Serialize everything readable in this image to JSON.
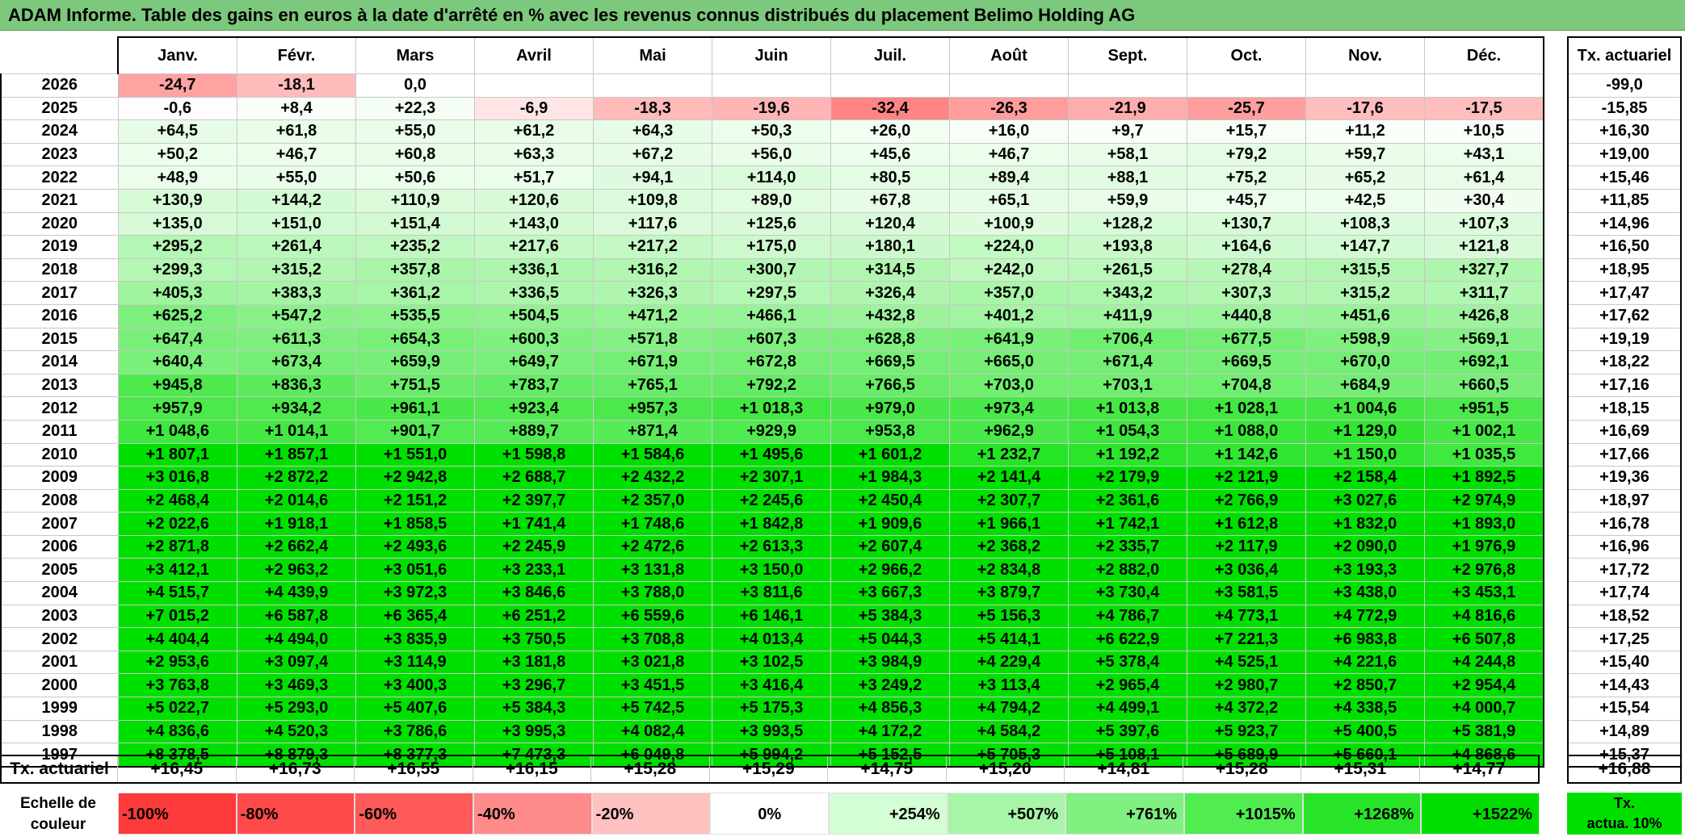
{
  "title": "ADAM Informe. Table des gains en euros à la date d'arrêté en % avec les revenus connus distribués du placement Belimo Holding AG",
  "months": [
    "Janv.",
    "Févr.",
    "Mars",
    "Avril",
    "Mai",
    "Juin",
    "Juil.",
    "Août",
    "Sept.",
    "Oct.",
    "Nov.",
    "Déc."
  ],
  "actu_header": "Tx. actuariel",
  "colors": {
    "title_bg": "#7cc87c",
    "neg_max": "#ff3030",
    "pos_max": "#00e000",
    "neutral": "#ffffff"
  },
  "chart_data": {
    "type": "heatmap",
    "title": "ADAM Informe. Table des gains en euros à la date d'arrêté en % avec les revenus connus distribués du placement Belimo Holding AG",
    "columns": [
      "Janv.",
      "Févr.",
      "Mars",
      "Avril",
      "Mai",
      "Juin",
      "Juil.",
      "Août",
      "Sept.",
      "Oct.",
      "Nov.",
      "Déc."
    ],
    "rows": [
      {
        "year": "2026",
        "values": [
          "-24,7",
          "-18,1",
          "0,0",
          "",
          "",
          "",
          "",
          "",
          "",
          "",
          "",
          ""
        ],
        "actu": "-99,0"
      },
      {
        "year": "2025",
        "values": [
          "-0,6",
          "+8,4",
          "+22,3",
          "-6,9",
          "-18,3",
          "-19,6",
          "-32,4",
          "-26,3",
          "-21,9",
          "-25,7",
          "-17,6",
          "-17,5"
        ],
        "actu": "-15,85"
      },
      {
        "year": "2024",
        "values": [
          "+64,5",
          "+61,8",
          "+55,0",
          "+61,2",
          "+64,3",
          "+50,3",
          "+26,0",
          "+16,0",
          "+9,7",
          "+15,7",
          "+11,2",
          "+10,5"
        ],
        "actu": "+16,30"
      },
      {
        "year": "2023",
        "values": [
          "+50,2",
          "+46,7",
          "+60,8",
          "+63,3",
          "+67,2",
          "+56,0",
          "+45,6",
          "+46,7",
          "+58,1",
          "+79,2",
          "+59,7",
          "+43,1"
        ],
        "actu": "+19,00"
      },
      {
        "year": "2022",
        "values": [
          "+48,9",
          "+55,0",
          "+50,6",
          "+51,7",
          "+94,1",
          "+114,0",
          "+80,5",
          "+89,4",
          "+88,1",
          "+75,2",
          "+65,2",
          "+61,4"
        ],
        "actu": "+15,46"
      },
      {
        "year": "2021",
        "values": [
          "+130,9",
          "+144,2",
          "+110,9",
          "+120,6",
          "+109,8",
          "+89,0",
          "+67,8",
          "+65,1",
          "+59,9",
          "+45,7",
          "+42,5",
          "+30,4"
        ],
        "actu": "+11,85"
      },
      {
        "year": "2020",
        "values": [
          "+135,0",
          "+151,0",
          "+151,4",
          "+143,0",
          "+117,6",
          "+125,6",
          "+120,4",
          "+100,9",
          "+128,2",
          "+130,7",
          "+108,3",
          "+107,3"
        ],
        "actu": "+14,96"
      },
      {
        "year": "2019",
        "values": [
          "+295,2",
          "+261,4",
          "+235,2",
          "+217,6",
          "+217,2",
          "+175,0",
          "+180,1",
          "+224,0",
          "+193,8",
          "+164,6",
          "+147,7",
          "+121,8"
        ],
        "actu": "+16,50"
      },
      {
        "year": "2018",
        "values": [
          "+299,3",
          "+315,2",
          "+357,8",
          "+336,1",
          "+316,2",
          "+300,7",
          "+314,5",
          "+242,0",
          "+261,5",
          "+278,4",
          "+315,5",
          "+327,7"
        ],
        "actu": "+18,95"
      },
      {
        "year": "2017",
        "values": [
          "+405,3",
          "+383,3",
          "+361,2",
          "+336,5",
          "+326,3",
          "+297,5",
          "+326,4",
          "+357,0",
          "+343,2",
          "+307,3",
          "+315,2",
          "+311,7"
        ],
        "actu": "+17,47"
      },
      {
        "year": "2016",
        "values": [
          "+625,2",
          "+547,2",
          "+535,5",
          "+504,5",
          "+471,2",
          "+466,1",
          "+432,8",
          "+401,2",
          "+411,9",
          "+440,8",
          "+451,6",
          "+426,8"
        ],
        "actu": "+17,62"
      },
      {
        "year": "2015",
        "values": [
          "+647,4",
          "+611,3",
          "+654,3",
          "+600,3",
          "+571,8",
          "+607,3",
          "+628,8",
          "+641,9",
          "+706,4",
          "+677,5",
          "+598,9",
          "+569,1"
        ],
        "actu": "+19,19"
      },
      {
        "year": "2014",
        "values": [
          "+640,4",
          "+673,4",
          "+659,9",
          "+649,7",
          "+671,9",
          "+672,8",
          "+669,5",
          "+665,0",
          "+671,4",
          "+669,5",
          "+670,0",
          "+692,1"
        ],
        "actu": "+18,22"
      },
      {
        "year": "2013",
        "values": [
          "+945,8",
          "+836,3",
          "+751,5",
          "+783,7",
          "+765,1",
          "+792,2",
          "+766,5",
          "+703,0",
          "+703,1",
          "+704,8",
          "+684,9",
          "+660,5"
        ],
        "actu": "+17,16"
      },
      {
        "year": "2012",
        "values": [
          "+957,9",
          "+934,2",
          "+961,1",
          "+923,4",
          "+957,3",
          "+1 018,3",
          "+979,0",
          "+973,4",
          "+1 013,8",
          "+1 028,1",
          "+1 004,6",
          "+951,5"
        ],
        "actu": "+18,15"
      },
      {
        "year": "2011",
        "values": [
          "+1 048,6",
          "+1 014,1",
          "+901,7",
          "+889,7",
          "+871,4",
          "+929,9",
          "+953,8",
          "+962,9",
          "+1 054,3",
          "+1 088,0",
          "+1 129,0",
          "+1 002,1"
        ],
        "actu": "+16,69"
      },
      {
        "year": "2010",
        "values": [
          "+1 807,1",
          "+1 857,1",
          "+1 551,0",
          "+1 598,8",
          "+1 584,6",
          "+1 495,6",
          "+1 601,2",
          "+1 232,7",
          "+1 192,2",
          "+1 142,6",
          "+1 150,0",
          "+1 035,5"
        ],
        "actu": "+17,66"
      },
      {
        "year": "2009",
        "values": [
          "+3 016,8",
          "+2 872,2",
          "+2 942,8",
          "+2 688,7",
          "+2 432,2",
          "+2 307,1",
          "+1 984,3",
          "+2 141,4",
          "+2 179,9",
          "+2 121,9",
          "+2 158,4",
          "+1 892,5"
        ],
        "actu": "+19,36"
      },
      {
        "year": "2008",
        "values": [
          "+2 468,4",
          "+2 014,6",
          "+2 151,2",
          "+2 397,7",
          "+2 357,0",
          "+2 245,6",
          "+2 450,4",
          "+2 307,7",
          "+2 361,6",
          "+2 766,9",
          "+3 027,6",
          "+2 974,9"
        ],
        "actu": "+18,97"
      },
      {
        "year": "2007",
        "values": [
          "+2 022,6",
          "+1 918,1",
          "+1 858,5",
          "+1 741,4",
          "+1 748,6",
          "+1 842,8",
          "+1 909,6",
          "+1 966,1",
          "+1 742,1",
          "+1 612,8",
          "+1 832,0",
          "+1 893,0"
        ],
        "actu": "+16,78"
      },
      {
        "year": "2006",
        "values": [
          "+2 871,8",
          "+2 662,4",
          "+2 493,6",
          "+2 245,9",
          "+2 472,6",
          "+2 613,3",
          "+2 607,4",
          "+2 368,2",
          "+2 335,7",
          "+2 117,9",
          "+2 090,0",
          "+1 976,9"
        ],
        "actu": "+16,96"
      },
      {
        "year": "2005",
        "values": [
          "+3 412,1",
          "+2 963,2",
          "+3 051,6",
          "+3 233,1",
          "+3 131,8",
          "+3 150,0",
          "+2 966,2",
          "+2 834,8",
          "+2 882,0",
          "+3 036,4",
          "+3 193,3",
          "+2 976,8"
        ],
        "actu": "+17,72"
      },
      {
        "year": "2004",
        "values": [
          "+4 515,7",
          "+4 439,9",
          "+3 972,3",
          "+3 846,6",
          "+3 788,0",
          "+3 811,6",
          "+3 667,3",
          "+3 879,7",
          "+3 730,4",
          "+3 581,5",
          "+3 438,0",
          "+3 453,1"
        ],
        "actu": "+17,74"
      },
      {
        "year": "2003",
        "values": [
          "+7 015,2",
          "+6 587,8",
          "+6 365,4",
          "+6 251,2",
          "+6 559,6",
          "+6 146,1",
          "+5 384,3",
          "+5 156,3",
          "+4 786,7",
          "+4 773,1",
          "+4 772,9",
          "+4 816,6"
        ],
        "actu": "+18,52"
      },
      {
        "year": "2002",
        "values": [
          "+4 404,4",
          "+4 494,0",
          "+3 835,9",
          "+3 750,5",
          "+3 708,8",
          "+4 013,4",
          "+5 044,3",
          "+5 414,1",
          "+6 622,9",
          "+7 221,3",
          "+6 983,8",
          "+6 507,8"
        ],
        "actu": "+17,25"
      },
      {
        "year": "2001",
        "values": [
          "+2 953,6",
          "+3 097,4",
          "+3 114,9",
          "+3 181,8",
          "+3 021,8",
          "+3 102,5",
          "+3 984,9",
          "+4 229,4",
          "+5 378,4",
          "+4 525,1",
          "+4 221,6",
          "+4 244,8"
        ],
        "actu": "+15,40"
      },
      {
        "year": "2000",
        "values": [
          "+3 763,8",
          "+3 469,3",
          "+3 400,3",
          "+3 296,7",
          "+3 451,5",
          "+3 416,4",
          "+3 249,2",
          "+3 113,4",
          "+2 965,4",
          "+2 980,7",
          "+2 850,7",
          "+2 954,4"
        ],
        "actu": "+14,43"
      },
      {
        "year": "1999",
        "values": [
          "+5 022,7",
          "+5 293,0",
          "+5 407,6",
          "+5 384,3",
          "+5 742,5",
          "+5 175,3",
          "+4 856,3",
          "+4 794,2",
          "+4 499,1",
          "+4 372,2",
          "+4 338,5",
          "+4 000,7"
        ],
        "actu": "+15,54"
      },
      {
        "year": "1998",
        "values": [
          "+4 836,6",
          "+4 520,3",
          "+3 786,6",
          "+3 995,3",
          "+4 082,4",
          "+3 993,5",
          "+4 172,2",
          "+4 584,2",
          "+5 397,6",
          "+5 923,7",
          "+5 400,5",
          "+5 381,9"
        ],
        "actu": "+14,89"
      },
      {
        "year": "1997",
        "values": [
          "+8 378,5",
          "+8 879,3",
          "+8 377,3",
          "+7 473,3",
          "+6 049,8",
          "+5 994,2",
          "+5 152,5",
          "+5 705,3",
          "+5 108,1",
          "+5 689,9",
          "+5 660,1",
          "+4 868,6"
        ],
        "actu": "+15,37"
      }
    ],
    "summary": {
      "label": "Tx. actuariel",
      "values": [
        "+16,45",
        "+16,73",
        "+16,55",
        "+16,15",
        "+15,28",
        "+15,29",
        "+14,75",
        "+15,20",
        "+14,81",
        "+15,28",
        "+15,31",
        "+14,77"
      ],
      "actu": "+16,88"
    },
    "scale": {
      "label_line1": "Echelle de",
      "label_line2": "couleur",
      "steps": [
        {
          "text": "-100%",
          "color": "#ff3a3a",
          "align": "left"
        },
        {
          "text": "-80%",
          "color": "#ff4a4a",
          "align": "left"
        },
        {
          "text": "-60%",
          "color": "#ff5a5a",
          "align": "left"
        },
        {
          "text": "-40%",
          "color": "#ff8a8a",
          "align": "left"
        },
        {
          "text": "-20%",
          "color": "#ffc0c0",
          "align": "left"
        },
        {
          "text": "0%",
          "color": "#ffffff",
          "align": "center"
        },
        {
          "text": "+254%",
          "color": "#d4ffd4",
          "align": "right"
        },
        {
          "text": "+507%",
          "color": "#a8f5a8",
          "align": "right"
        },
        {
          "text": "+761%",
          "color": "#80f080",
          "align": "right"
        },
        {
          "text": "+1015%",
          "color": "#50ec50",
          "align": "right"
        },
        {
          "text": "+1268%",
          "color": "#28e428",
          "align": "right"
        },
        {
          "text": "+1522%",
          "color": "#00dd00",
          "align": "right"
        }
      ],
      "actu_line1": "Tx.",
      "actu_line2": "actua. 10%"
    }
  }
}
